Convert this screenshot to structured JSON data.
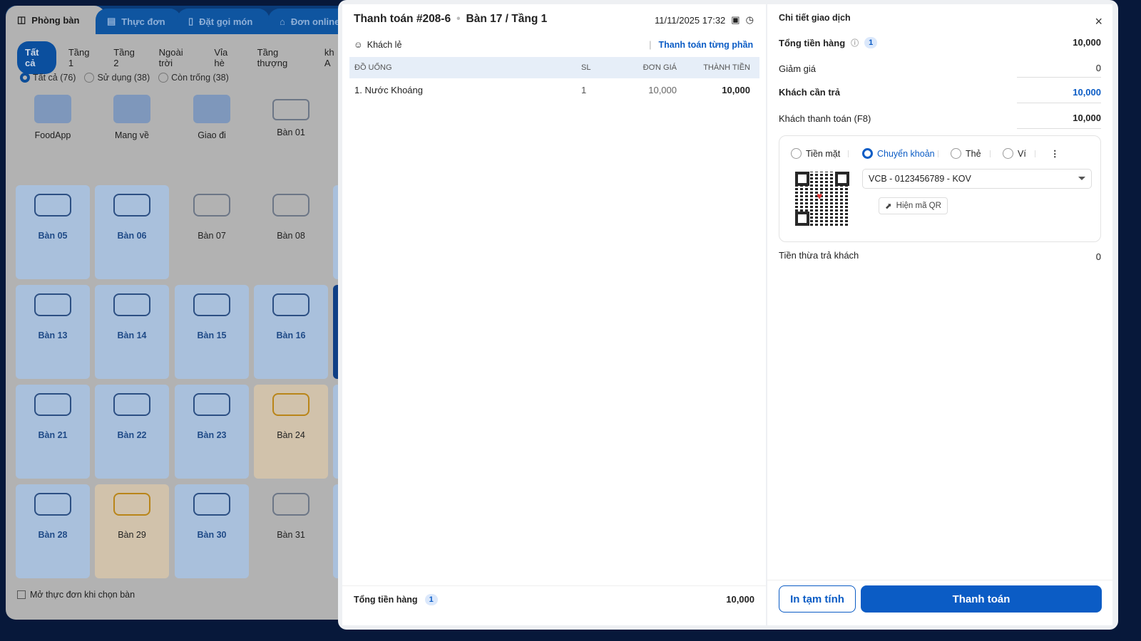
{
  "left": {
    "tabs": [
      {
        "label": "Phòng bàn",
        "icon": "table-icon"
      },
      {
        "label": "Thực đơn",
        "icon": "menu-icon"
      },
      {
        "label": "Đặt gọi món",
        "icon": "phone-order-icon"
      },
      {
        "label": "Đơn online",
        "icon": "bag-icon"
      }
    ],
    "floors": [
      "Tất cả",
      "Tầng 1",
      "Tầng 2",
      "Ngoài trời",
      "Vỉa hè",
      "Tầng thượng",
      "kh A"
    ],
    "filters": [
      "Tất cả (76)",
      "Sử dụng (38)",
      "Còn trống (38)"
    ],
    "specials": [
      "FoodApp",
      "Mang về",
      "Giao đi",
      "Bàn 01"
    ],
    "tables": [
      {
        "name": "Bàn 05",
        "status": "used"
      },
      {
        "name": "Bàn 06",
        "status": "used"
      },
      {
        "name": "Bàn 07",
        "status": "empty"
      },
      {
        "name": "Bàn 08",
        "status": "empty"
      },
      {
        "name": "Bàn 13",
        "status": "used"
      },
      {
        "name": "Bàn 14",
        "status": "used"
      },
      {
        "name": "Bàn 15",
        "status": "used"
      },
      {
        "name": "Bàn 16",
        "status": "used"
      },
      {
        "name": "Bàn 21",
        "status": "used"
      },
      {
        "name": "Bàn 22",
        "status": "used"
      },
      {
        "name": "Bàn 23",
        "status": "used"
      },
      {
        "name": "Bàn 24",
        "status": "busy"
      },
      {
        "name": "Bàn 28",
        "status": "used"
      },
      {
        "name": "Bàn 29",
        "status": "busy"
      },
      {
        "name": "Bàn 30",
        "status": "used"
      },
      {
        "name": "Bàn 31",
        "status": "empty"
      }
    ],
    "open_menu_checkbox": "Mở thực đơn khi chọn bàn"
  },
  "order": {
    "title": "Thanh toán #208-6",
    "table": "Bàn 17 / Tầng 1",
    "datetime": "11/11/2025 17:32",
    "customer": "Khách lẻ",
    "split_payment": "Thanh toán từng phần",
    "columns": [
      "ĐỒ UỐNG",
      "SL",
      "ĐƠN GIÁ",
      "THÀNH TIỀN"
    ],
    "items": [
      {
        "name": "1. Nước Khoáng",
        "qty": "1",
        "price": "10,000",
        "total": "10,000"
      }
    ],
    "footer_label": "Tổng tiền hàng",
    "footer_count": "1",
    "footer_total": "10,000"
  },
  "detail": {
    "title": "Chi tiết giao dịch",
    "subtotal_label": "Tổng tiền hàng",
    "subtotal_count": "1",
    "subtotal": "10,000",
    "discount_label": "Giảm giá",
    "discount": "0",
    "due_label": "Khách cần trả",
    "due": "10,000",
    "paid_label": "Khách thanh toán (F8)",
    "paid": "10,000",
    "methods": [
      "Tiền mặt",
      "Chuyển khoản",
      "Thẻ",
      "Ví"
    ],
    "selected_method": "Chuyển khoản",
    "bank_account": "VCB - 0123456789 - KOV",
    "show_qr": "Hiện mã QR",
    "change_label": "Tiền thừa trả khách",
    "change": "0",
    "print_button": "In tạm tính",
    "pay_button": "Thanh toán"
  },
  "colors": {
    "accent": "#0b5cc5",
    "navy": "#07183a"
  }
}
